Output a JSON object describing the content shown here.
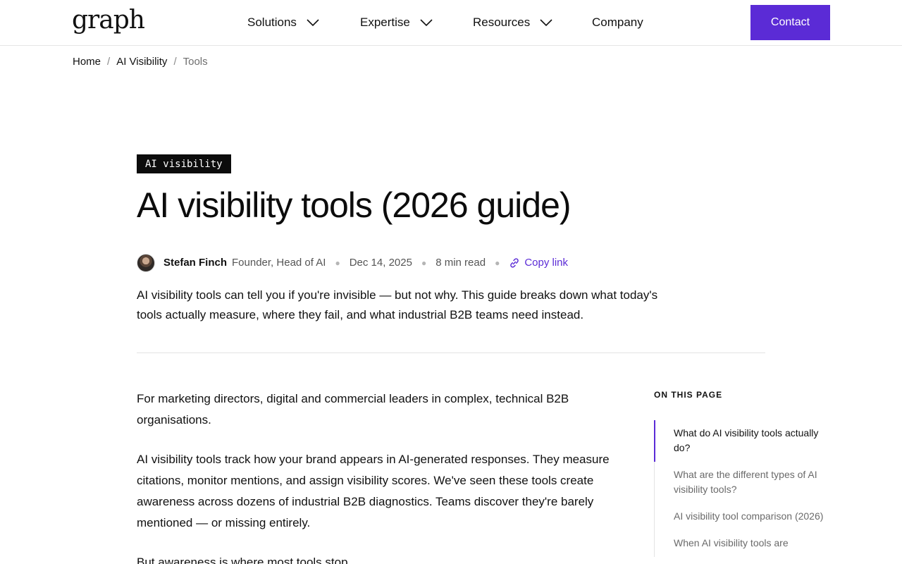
{
  "header": {
    "logo": "graph",
    "nav": [
      {
        "label": "Solutions",
        "has_dropdown": true
      },
      {
        "label": "Expertise",
        "has_dropdown": true
      },
      {
        "label": "Resources",
        "has_dropdown": true
      },
      {
        "label": "Company",
        "has_dropdown": false
      }
    ],
    "contact_label": "Contact"
  },
  "breadcrumb": {
    "items": [
      "Home",
      "AI Visibility",
      "Tools"
    ],
    "separator": "/"
  },
  "article": {
    "tag": "AI visibility",
    "title": "AI visibility tools (2026 guide)",
    "author": "Stefan Finch",
    "author_role": "Founder, Head of AI",
    "date": "Dec 14, 2025",
    "read_time": "8 min read",
    "copy_link": "Copy link",
    "intro": "AI visibility tools can tell you if you're invisible — but not why. This guide breaks down what today's tools actually measure, where they fail, and what industrial B2B teams need instead.",
    "paragraphs": [
      "For marketing directors, digital and commercial leaders in complex, technical B2B organisations.",
      "AI visibility tools track how your brand appears in AI-generated responses. They measure citations, monitor mentions, and assign visibility scores. We've seen these tools create awareness across dozens of industrial B2B diagnostics. Teams discover they're barely mentioned — or missing entirely.",
      "But awareness is where most tools stop."
    ]
  },
  "toc": {
    "title": "ON THIS PAGE",
    "items": [
      {
        "label": "What do AI visibility tools actually do?",
        "active": true
      },
      {
        "label": "What are the different types of AI visibility tools?",
        "active": false
      },
      {
        "label": "AI visibility tool comparison (2026)",
        "active": false
      },
      {
        "label": "When AI visibility tools are",
        "active": false
      }
    ]
  },
  "colors": {
    "accent": "#5b2bd6",
    "tag_bg": "#0c0c0c",
    "text": "#111111",
    "muted": "#6a6a6a"
  },
  "icons": [
    "chevron-down-icon",
    "link-icon"
  ]
}
